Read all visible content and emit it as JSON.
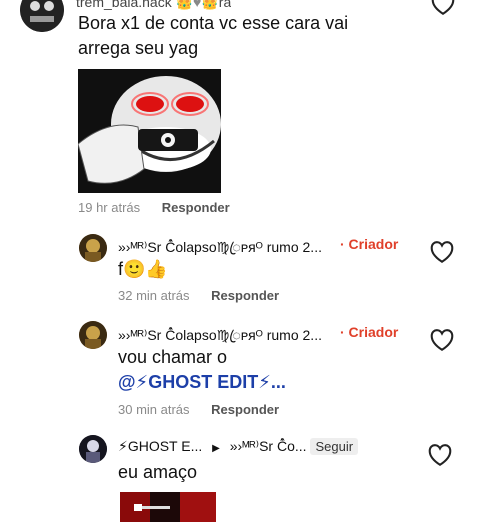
{
  "comments": [
    {
      "username": "trem_bala.hack",
      "username_suffix": "ra",
      "text_line1": "Bora x1 de conta vc esse cara vai",
      "text_line2": "arrega  seu yag",
      "time": "19 hr atrás",
      "reply_label": "Responder"
    },
    {
      "username": "»›ᴹᴿ⁾Sr Ĉ̊olapso♍ꦿᴘᴙᴼ rumo 2...",
      "creator_label": "· Criador",
      "text": "f",
      "emojis": "🙂👍",
      "time": "32 min atrás",
      "reply_label": "Responder"
    },
    {
      "username": "»›ᴹᴿ⁾Sr Ĉ̊olapso♍ꦿᴘᴙᴼ rumo 2...",
      "creator_label": "· Criador",
      "text_line1": "vou chamar o",
      "mention": "@⚡GHOST EDIT⚡...",
      "time": "30 min atrás",
      "reply_label": "Responder"
    },
    {
      "username": "⚡GHOST E...",
      "reply_arrow": "▶",
      "reply_to": "»›ᴹᴿ⁾Sr Ĉ̊o...",
      "follow_label": "Seguir",
      "text": "eu amaço"
    }
  ]
}
